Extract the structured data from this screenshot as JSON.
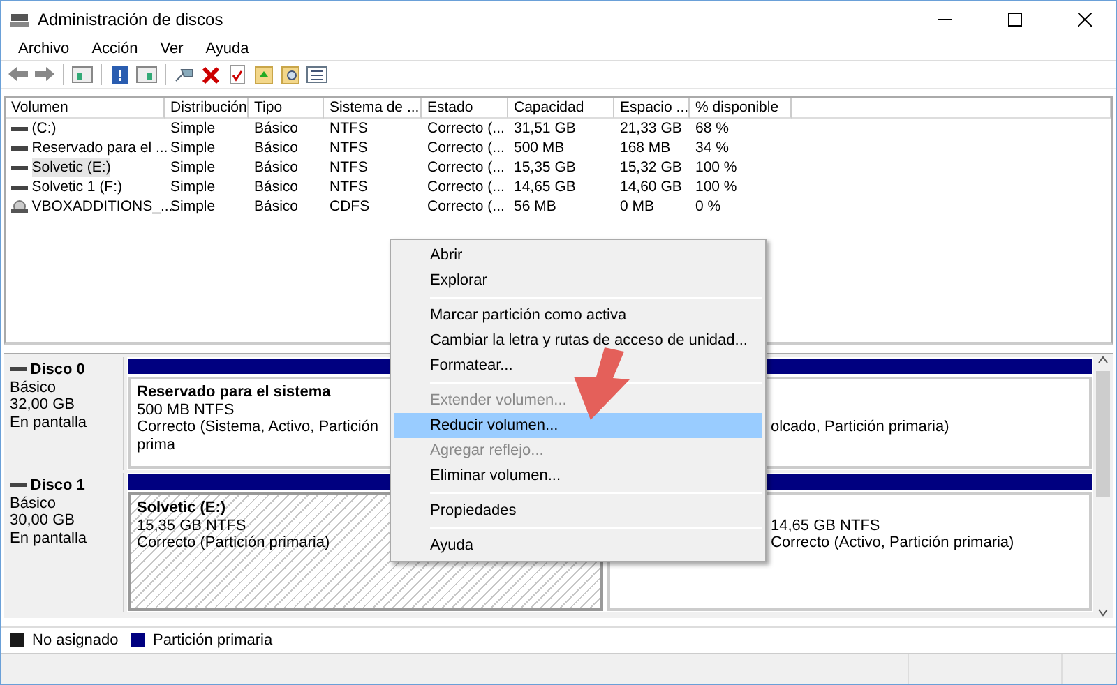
{
  "window": {
    "title": "Administración de discos"
  },
  "menu": [
    "Archivo",
    "Acción",
    "Ver",
    "Ayuda"
  ],
  "volumes": {
    "columns": [
      "Volumen",
      "Distribución",
      "Tipo",
      "Sistema de ...",
      "Estado",
      "Capacidad",
      "Espacio ...",
      "% disponible"
    ],
    "rows": [
      {
        "kind": "disk",
        "selected": false,
        "cells": [
          " (C:)",
          "Simple",
          "Básico",
          "NTFS",
          "Correcto (...",
          "31,51 GB",
          "21,33 GB",
          "68 %"
        ]
      },
      {
        "kind": "disk",
        "selected": false,
        "cells": [
          "Reservado para el ...",
          "Simple",
          "Básico",
          "NTFS",
          "Correcto (...",
          "500 MB",
          "168 MB",
          "34 %"
        ]
      },
      {
        "kind": "disk",
        "selected": true,
        "cells": [
          "Solvetic (E:)",
          "Simple",
          "Básico",
          "NTFS",
          "Correcto (...",
          "15,35 GB",
          "15,32 GB",
          "100 %"
        ]
      },
      {
        "kind": "disk",
        "selected": false,
        "cells": [
          "Solvetic 1 (F:)",
          "Simple",
          "Básico",
          "NTFS",
          "Correcto (...",
          "14,65 GB",
          "14,60 GB",
          "100 %"
        ]
      },
      {
        "kind": "cd",
        "selected": false,
        "cells": [
          "VBOXADDITIONS_...",
          "Simple",
          "Básico",
          "CDFS",
          "Correcto (...",
          "56 MB",
          "0 MB",
          "0 %"
        ]
      }
    ]
  },
  "disks": [
    {
      "name": "Disco 0",
      "type": "Básico",
      "size": "32,00 GB",
      "status": "En pantalla",
      "partitions": [
        {
          "selected": false,
          "name": "Reservado para el sistema",
          "size": "500 MB NTFS",
          "status": "Correcto (Sistema, Activo, Partición prima"
        },
        {
          "selected": false,
          "status": "olcado, Partición primaria)"
        }
      ]
    },
    {
      "name": "Disco 1",
      "type": "Básico",
      "size": "30,00 GB",
      "status": "En pantalla",
      "partitions": [
        {
          "selected": true,
          "name": "Solvetic  (E:)",
          "size": "15,35 GB NTFS",
          "status": "Correcto (Partición primaria)"
        },
        {
          "selected": false,
          "size": "14,65 GB NTFS",
          "status": "Correcto (Activo, Partición primaria)"
        }
      ]
    }
  ],
  "context_menu": {
    "groups": [
      [
        {
          "label": "Abrir",
          "disabled": false,
          "highlighted": false
        },
        {
          "label": "Explorar",
          "disabled": false,
          "highlighted": false
        }
      ],
      [
        {
          "label": "Marcar partición como activa",
          "disabled": false,
          "highlighted": false
        },
        {
          "label": "Cambiar la letra y rutas de acceso de unidad...",
          "disabled": false,
          "highlighted": false
        },
        {
          "label": "Formatear...",
          "disabled": false,
          "highlighted": false
        }
      ],
      [
        {
          "label": "Extender volumen...",
          "disabled": true,
          "highlighted": false
        },
        {
          "label": "Reducir volumen...",
          "disabled": false,
          "highlighted": true
        },
        {
          "label": "Agregar reflejo...",
          "disabled": true,
          "highlighted": false
        },
        {
          "label": "Eliminar volumen...",
          "disabled": false,
          "highlighted": false
        }
      ],
      [
        {
          "label": "Propiedades",
          "disabled": false,
          "highlighted": false
        }
      ],
      [
        {
          "label": "Ayuda",
          "disabled": false,
          "highlighted": false
        }
      ]
    ]
  },
  "legend": [
    {
      "label": "No asignado",
      "color": "#1a1a1a"
    },
    {
      "label": "Partición primaria",
      "color": "#000080"
    }
  ]
}
